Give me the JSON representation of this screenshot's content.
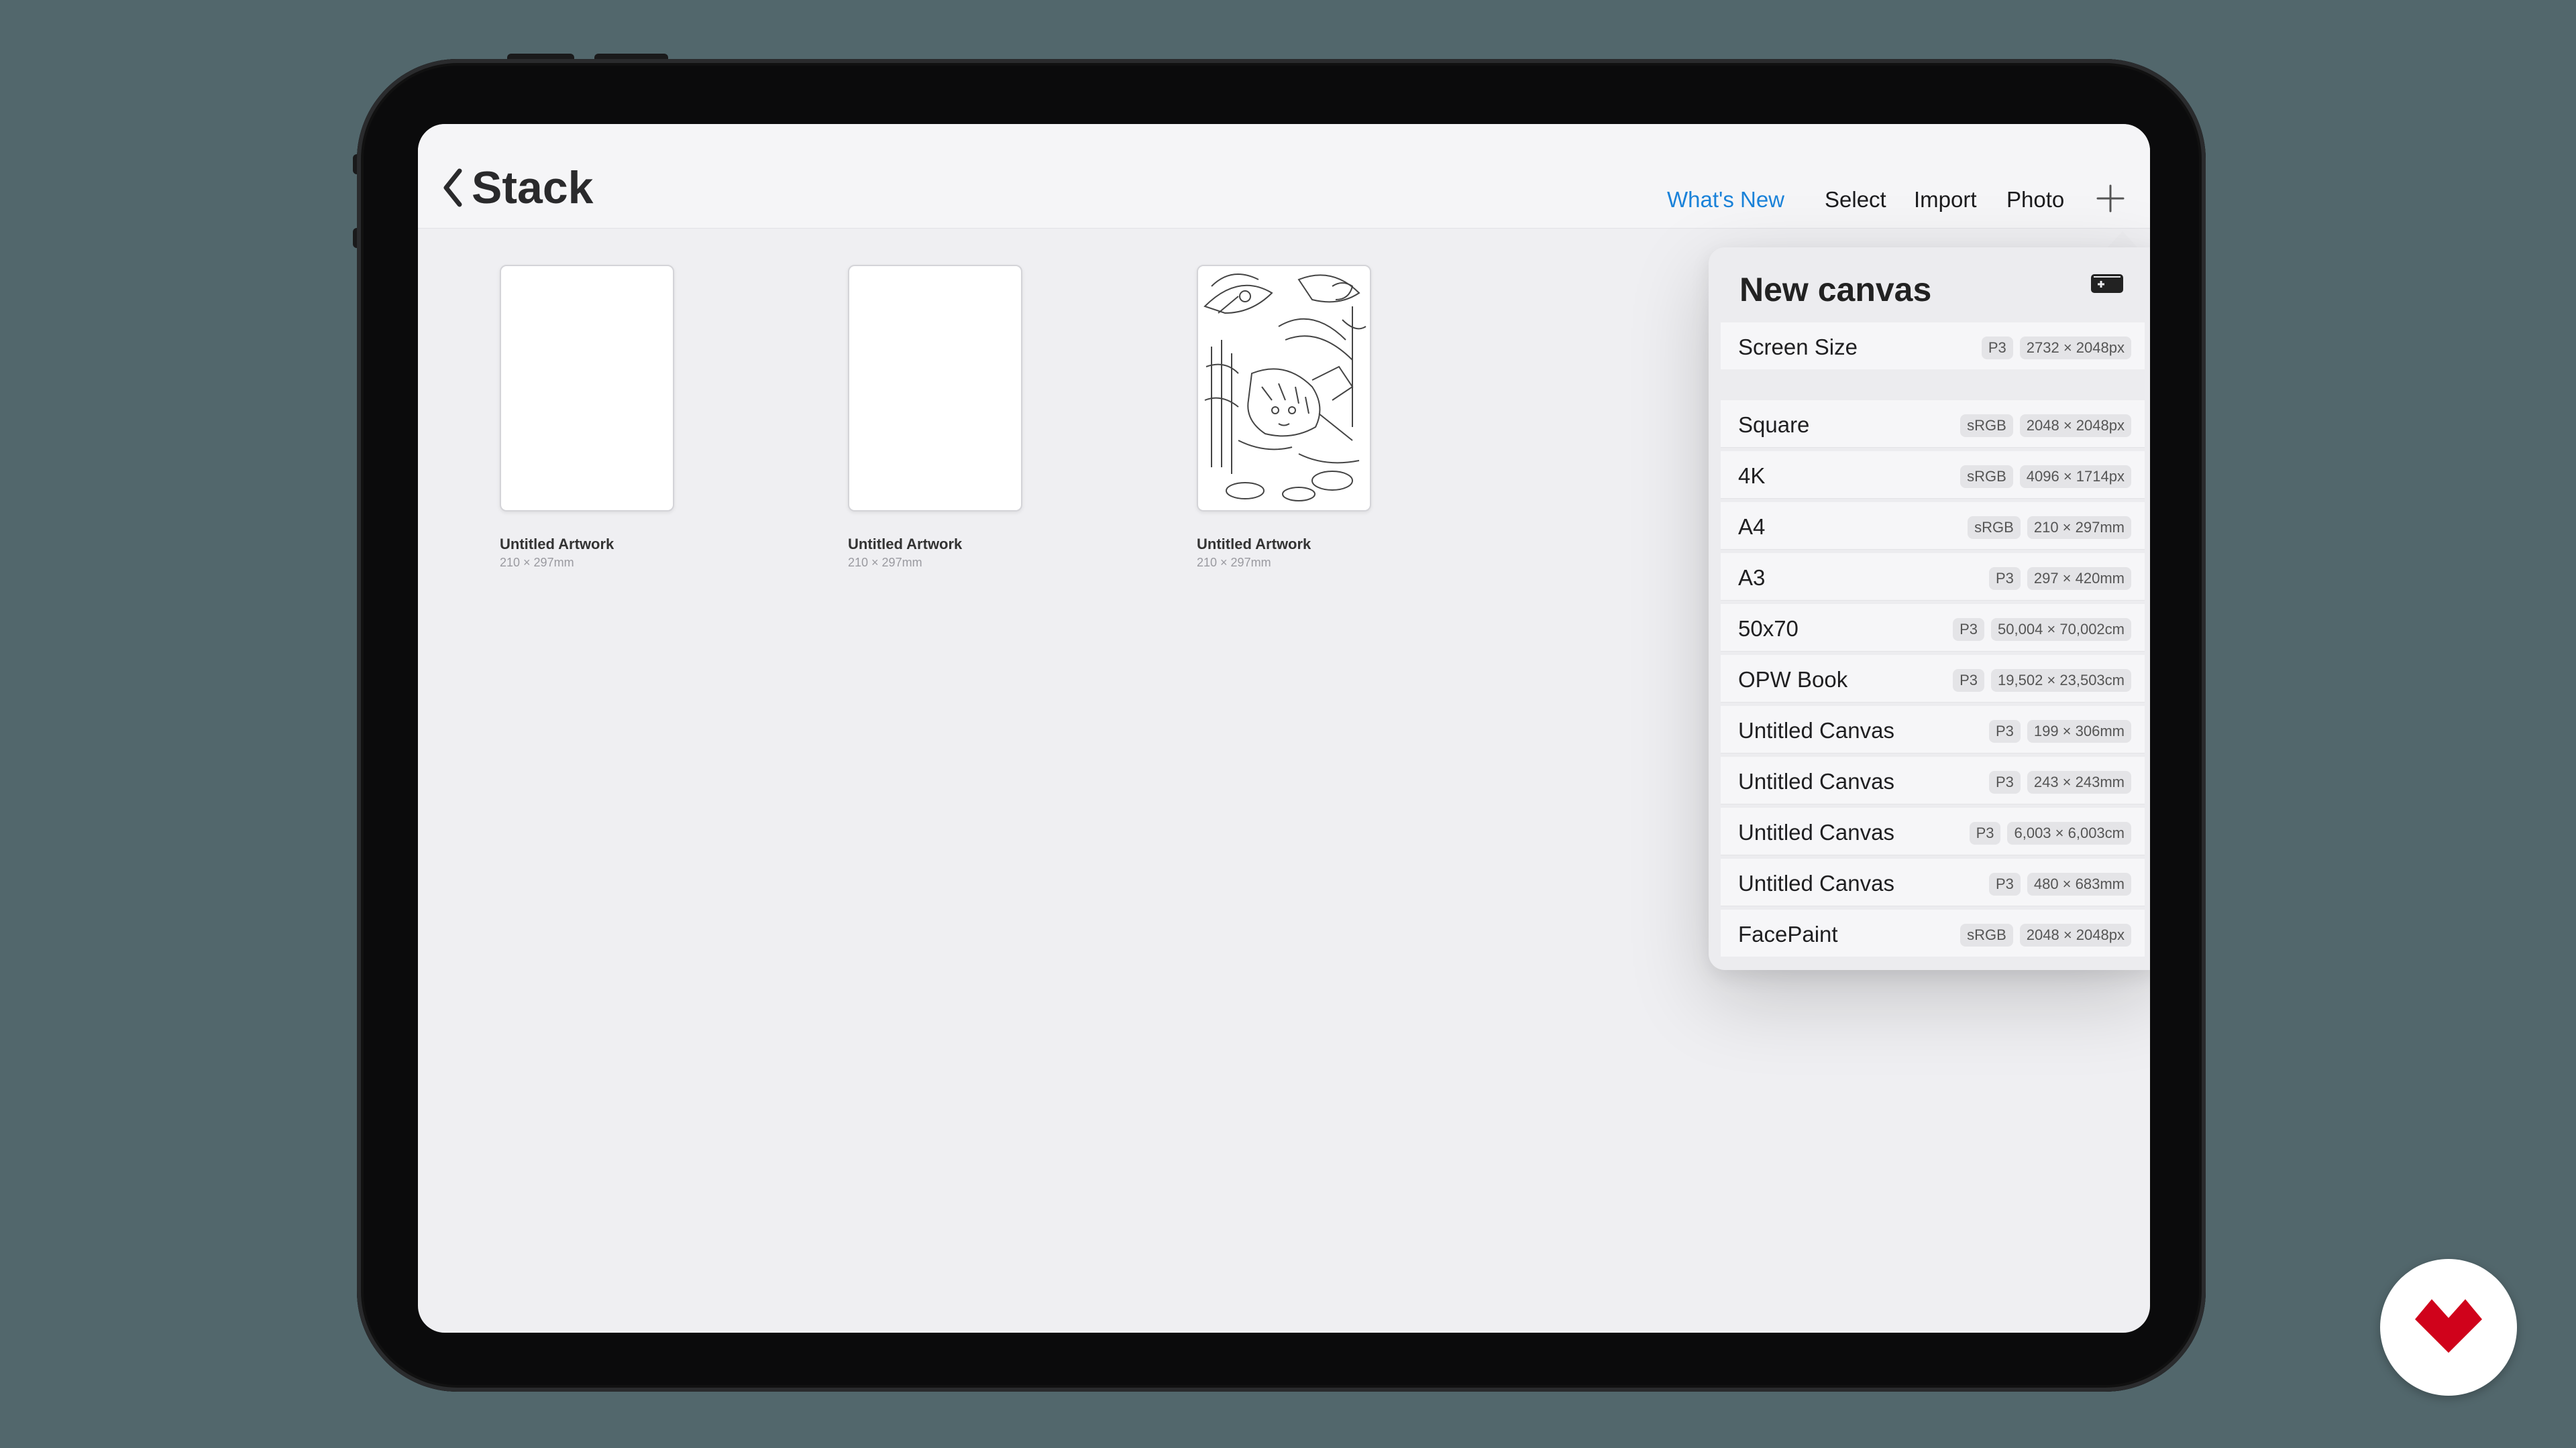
{
  "navbar": {
    "title": "Stack",
    "whats_new": "What's New",
    "select": "Select",
    "import": "Import",
    "photo": "Photo"
  },
  "gallery": {
    "items": [
      {
        "title": "Untitled Artwork",
        "size": "210 × 297mm"
      },
      {
        "title": "Untitled Artwork",
        "size": "210 × 297mm"
      },
      {
        "title": "Untitled Artwork",
        "size": "210 × 297mm"
      }
    ]
  },
  "new_canvas": {
    "title": "New canvas",
    "screen_size": {
      "label": "Screen Size",
      "color": "P3",
      "dims": "2732 × 2048px"
    },
    "presets": [
      {
        "label": "Square",
        "color": "sRGB",
        "dims": "2048 × 2048px"
      },
      {
        "label": "4K",
        "color": "sRGB",
        "dims": "4096 × 1714px"
      },
      {
        "label": "A4",
        "color": "sRGB",
        "dims": "210 × 297mm"
      },
      {
        "label": "A3",
        "color": "P3",
        "dims": "297 × 420mm"
      },
      {
        "label": "50x70",
        "color": "P3",
        "dims": "50,004 × 70,002cm"
      },
      {
        "label": "OPW Book",
        "color": "P3",
        "dims": "19,502 × 23,503cm"
      },
      {
        "label": "Untitled Canvas",
        "color": "P3",
        "dims": "199 × 306mm"
      },
      {
        "label": "Untitled Canvas",
        "color": "P3",
        "dims": "243 × 243mm"
      },
      {
        "label": "Untitled Canvas",
        "color": "P3",
        "dims": "6,003 × 6,003cm"
      },
      {
        "label": "Untitled Canvas",
        "color": "P3",
        "dims": "480 × 683mm"
      },
      {
        "label": "FacePaint",
        "color": "sRGB",
        "dims": "2048 × 2048px"
      }
    ]
  },
  "colors": {
    "background": "#52676c",
    "accent": "#1a82d9",
    "logo": "#d0021b"
  }
}
